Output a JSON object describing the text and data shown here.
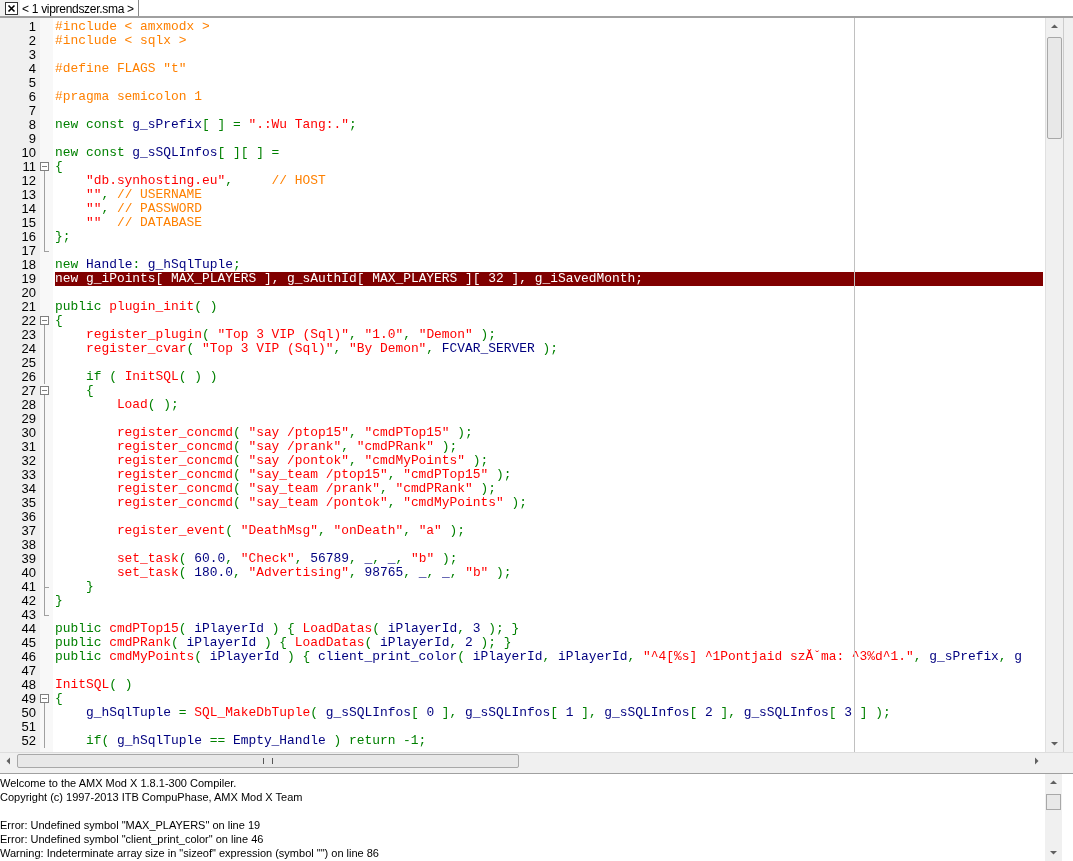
{
  "tab": {
    "label": "< 1 viprendszer.sma >",
    "selected": true
  },
  "lines": [
    {
      "number": "1",
      "kind": "plain",
      "highlighted": false,
      "tokens": [
        {
          "kind": "pre",
          "text": "#include < amxmodx >"
        }
      ]
    },
    {
      "number": "2",
      "kind": "plain",
      "highlighted": false,
      "tokens": [
        {
          "kind": "pre",
          "text": "#include < sqlx >"
        }
      ]
    },
    {
      "number": "3",
      "kind": "plain",
      "highlighted": false
    },
    {
      "number": "4",
      "kind": "plain",
      "highlighted": false,
      "tokens": [
        {
          "kind": "pre",
          "text": "#define FLAGS \"t\""
        }
      ]
    },
    {
      "number": "5",
      "kind": "plain",
      "highlighted": false
    },
    {
      "number": "6",
      "kind": "plain",
      "highlighted": false,
      "tokens": [
        {
          "kind": "pre",
          "text": "#pragma semicolon 1"
        }
      ]
    },
    {
      "number": "7",
      "kind": "plain",
      "highlighted": false
    },
    {
      "number": "8",
      "kind": "plain",
      "highlighted": false,
      "tokens": [
        {
          "kind": "kw",
          "text": "new const "
        },
        {
          "kind": "id",
          "text": "g_sPrefix"
        },
        {
          "kind": "kw",
          "text": "[ ] = "
        },
        {
          "kind": "str",
          "text": "\".:Wu Tang:.\""
        },
        {
          "kind": "kw",
          "text": ";"
        }
      ]
    },
    {
      "number": "9",
      "kind": "plain",
      "highlighted": false
    },
    {
      "number": "10",
      "kind": "plain",
      "highlighted": false,
      "tokens": [
        {
          "kind": "kw",
          "text": "new const "
        },
        {
          "kind": "id",
          "text": "g_sSQLInfos"
        },
        {
          "kind": "kw",
          "text": "[ ][ ] ="
        }
      ]
    },
    {
      "number": "11",
      "kind": "fold-start",
      "highlighted": false,
      "tokens": [
        {
          "kind": "kw",
          "text": "{"
        }
      ]
    },
    {
      "number": "12",
      "kind": "fold-body",
      "highlighted": false,
      "tokens": [
        {
          "kind": "str",
          "text": "    \"db.synhosting.eu\""
        },
        {
          "kind": "kw",
          "text": ",     "
        },
        {
          "kind": "cm",
          "text": "// HOST"
        }
      ]
    },
    {
      "number": "13",
      "kind": "fold-body",
      "highlighted": false,
      "tokens": [
        {
          "kind": "str",
          "text": "    \"\""
        },
        {
          "kind": "kw",
          "text": ", "
        },
        {
          "kind": "cm",
          "text": "// USERNAME"
        }
      ]
    },
    {
      "number": "14",
      "kind": "fold-body",
      "highlighted": false,
      "tokens": [
        {
          "kind": "str",
          "text": "    \"\""
        },
        {
          "kind": "kw",
          "text": ", "
        },
        {
          "kind": "cm",
          "text": "// PASSWORD"
        }
      ]
    },
    {
      "number": "15",
      "kind": "fold-body",
      "highlighted": false,
      "tokens": [
        {
          "kind": "str",
          "text": "    \"\""
        },
        {
          "kind": "cm",
          "text": "  // DATABASE"
        }
      ]
    },
    {
      "number": "16",
      "kind": "fold-body",
      "highlighted": false,
      "tokens": [
        {
          "kind": "kw",
          "text": "};"
        }
      ]
    },
    {
      "number": "17",
      "kind": "fold-end",
      "highlighted": false
    },
    {
      "number": "18",
      "kind": "plain",
      "highlighted": false,
      "tokens": [
        {
          "kind": "kw",
          "text": "new "
        },
        {
          "kind": "id",
          "text": "Handle"
        },
        {
          "kind": "kw",
          "text": ": "
        },
        {
          "kind": "id",
          "text": "g_hSqlTuple"
        },
        {
          "kind": "kw",
          "text": ";"
        }
      ]
    },
    {
      "number": "19",
      "kind": "plain",
      "highlighted": true,
      "tokens": [
        {
          "kind": "kw",
          "text": "new "
        },
        {
          "kind": "id",
          "text": "g_iPoints"
        },
        {
          "kind": "kw",
          "text": "[ "
        },
        {
          "kind": "id",
          "text": "MAX_PLAYERS"
        },
        {
          "kind": "kw",
          "text": " ], "
        },
        {
          "kind": "id",
          "text": "g_sAuthId"
        },
        {
          "kind": "kw",
          "text": "[ "
        },
        {
          "kind": "id",
          "text": "MAX_PLAYERS"
        },
        {
          "kind": "kw",
          "text": " ][ "
        },
        {
          "kind": "num",
          "text": "32"
        },
        {
          "kind": "kw",
          "text": " ], "
        },
        {
          "kind": "id",
          "text": "g_iSavedMonth"
        },
        {
          "kind": "kw",
          "text": ";"
        }
      ]
    },
    {
      "number": "20",
      "kind": "plain",
      "highlighted": false
    },
    {
      "number": "21",
      "kind": "plain",
      "highlighted": false,
      "tokens": [
        {
          "kind": "kw",
          "text": "public "
        },
        {
          "kind": "fn",
          "text": "plugin_init"
        },
        {
          "kind": "kw",
          "text": "( )"
        }
      ]
    },
    {
      "number": "22",
      "kind": "fold-start",
      "highlighted": false,
      "tokens": [
        {
          "kind": "kw",
          "text": "{"
        }
      ]
    },
    {
      "number": "23",
      "kind": "fold-body",
      "highlighted": false,
      "tokens": [
        {
          "kind": "fn",
          "text": "    register_plugin"
        },
        {
          "kind": "kw",
          "text": "( "
        },
        {
          "kind": "str",
          "text": "\"Top 3 VIP (Sql)\""
        },
        {
          "kind": "kw",
          "text": ", "
        },
        {
          "kind": "str",
          "text": "\"1.0\""
        },
        {
          "kind": "kw",
          "text": ", "
        },
        {
          "kind": "str",
          "text": "\"Demon\""
        },
        {
          "kind": "kw",
          "text": " );"
        }
      ]
    },
    {
      "number": "24",
      "kind": "fold-body",
      "highlighted": false,
      "tokens": [
        {
          "kind": "fn",
          "text": "    register_cvar"
        },
        {
          "kind": "kw",
          "text": "( "
        },
        {
          "kind": "str",
          "text": "\"Top 3 VIP (Sql)\""
        },
        {
          "kind": "kw",
          "text": ", "
        },
        {
          "kind": "str",
          "text": "\"By Demon\""
        },
        {
          "kind": "kw",
          "text": ", "
        },
        {
          "kind": "id",
          "text": "FCVAR_SERVER"
        },
        {
          "kind": "kw",
          "text": " );"
        }
      ]
    },
    {
      "number": "25",
      "kind": "fold-body",
      "highlighted": false
    },
    {
      "number": "26",
      "kind": "fold-body",
      "highlighted": false,
      "tokens": [
        {
          "kind": "kw",
          "text": "    if ( "
        },
        {
          "kind": "fn",
          "text": "InitSQL"
        },
        {
          "kind": "kw",
          "text": "( ) )"
        }
      ]
    },
    {
      "number": "27",
      "kind": "fold-start",
      "highlighted": false,
      "tokens": [
        {
          "kind": "kw",
          "text": "    {"
        }
      ]
    },
    {
      "number": "28",
      "kind": "fold-body",
      "highlighted": false,
      "tokens": [
        {
          "kind": "fn",
          "text": "        Load"
        },
        {
          "kind": "kw",
          "text": "( );"
        }
      ]
    },
    {
      "number": "29",
      "kind": "fold-body",
      "highlighted": false
    },
    {
      "number": "30",
      "kind": "fold-body",
      "highlighted": false,
      "tokens": [
        {
          "kind": "fn",
          "text": "        register_concmd"
        },
        {
          "kind": "kw",
          "text": "( "
        },
        {
          "kind": "str",
          "text": "\"say /ptop15\""
        },
        {
          "kind": "kw",
          "text": ", "
        },
        {
          "kind": "str",
          "text": "\"cmdPTop15\""
        },
        {
          "kind": "kw",
          "text": " );"
        }
      ]
    },
    {
      "number": "31",
      "kind": "fold-body",
      "highlighted": false,
      "tokens": [
        {
          "kind": "fn",
          "text": "        register_concmd"
        },
        {
          "kind": "kw",
          "text": "( "
        },
        {
          "kind": "str",
          "text": "\"say /prank\""
        },
        {
          "kind": "kw",
          "text": ", "
        },
        {
          "kind": "str",
          "text": "\"cmdPRank\""
        },
        {
          "kind": "kw",
          "text": " );"
        }
      ]
    },
    {
      "number": "32",
      "kind": "fold-body",
      "highlighted": false,
      "tokens": [
        {
          "kind": "fn",
          "text": "        register_concmd"
        },
        {
          "kind": "kw",
          "text": "( "
        },
        {
          "kind": "str",
          "text": "\"say /pontok\""
        },
        {
          "kind": "kw",
          "text": ", "
        },
        {
          "kind": "str",
          "text": "\"cmdMyPoints\""
        },
        {
          "kind": "kw",
          "text": " );"
        }
      ]
    },
    {
      "number": "33",
      "kind": "fold-body",
      "highlighted": false,
      "tokens": [
        {
          "kind": "fn",
          "text": "        register_concmd"
        },
        {
          "kind": "kw",
          "text": "( "
        },
        {
          "kind": "str",
          "text": "\"say_team /ptop15\""
        },
        {
          "kind": "kw",
          "text": ", "
        },
        {
          "kind": "str",
          "text": "\"cmdPTop15\""
        },
        {
          "kind": "kw",
          "text": " );"
        }
      ]
    },
    {
      "number": "34",
      "kind": "fold-body",
      "highlighted": false,
      "tokens": [
        {
          "kind": "fn",
          "text": "        register_concmd"
        },
        {
          "kind": "kw",
          "text": "( "
        },
        {
          "kind": "str",
          "text": "\"say_team /prank\""
        },
        {
          "kind": "kw",
          "text": ", "
        },
        {
          "kind": "str",
          "text": "\"cmdPRank\""
        },
        {
          "kind": "kw",
          "text": " );"
        }
      ]
    },
    {
      "number": "35",
      "kind": "fold-body",
      "highlighted": false,
      "tokens": [
        {
          "kind": "fn",
          "text": "        register_concmd"
        },
        {
          "kind": "kw",
          "text": "( "
        },
        {
          "kind": "str",
          "text": "\"say_team /pontok\""
        },
        {
          "kind": "kw",
          "text": ", "
        },
        {
          "kind": "str",
          "text": "\"cmdMyPoints\""
        },
        {
          "kind": "kw",
          "text": " );"
        }
      ]
    },
    {
      "number": "36",
      "kind": "fold-body",
      "highlighted": false
    },
    {
      "number": "37",
      "kind": "fold-body",
      "highlighted": false,
      "tokens": [
        {
          "kind": "fn",
          "text": "        register_event"
        },
        {
          "kind": "kw",
          "text": "( "
        },
        {
          "kind": "str",
          "text": "\"DeathMsg\""
        },
        {
          "kind": "kw",
          "text": ", "
        },
        {
          "kind": "str",
          "text": "\"onDeath\""
        },
        {
          "kind": "kw",
          "text": ", "
        },
        {
          "kind": "str",
          "text": "\"a\""
        },
        {
          "kind": "kw",
          "text": " );"
        }
      ]
    },
    {
      "number": "38",
      "kind": "fold-body",
      "highlighted": false
    },
    {
      "number": "39",
      "kind": "fold-body",
      "highlighted": false,
      "tokens": [
        {
          "kind": "fn",
          "text": "        set_task"
        },
        {
          "kind": "kw",
          "text": "( "
        },
        {
          "kind": "num",
          "text": "60.0"
        },
        {
          "kind": "kw",
          "text": ", "
        },
        {
          "kind": "str",
          "text": "\"Check\""
        },
        {
          "kind": "kw",
          "text": ", "
        },
        {
          "kind": "num",
          "text": "56789"
        },
        {
          "kind": "kw",
          "text": ", "
        },
        {
          "kind": "id",
          "text": "_"
        },
        {
          "kind": "kw",
          "text": ", "
        },
        {
          "kind": "id",
          "text": "_"
        },
        {
          "kind": "kw",
          "text": ", "
        },
        {
          "kind": "str",
          "text": "\"b\""
        },
        {
          "kind": "kw",
          "text": " );"
        }
      ]
    },
    {
      "number": "40",
      "kind": "fold-body",
      "highlighted": false,
      "tokens": [
        {
          "kind": "fn",
          "text": "        set_task"
        },
        {
          "kind": "kw",
          "text": "( "
        },
        {
          "kind": "num",
          "text": "180.0"
        },
        {
          "kind": "kw",
          "text": ", "
        },
        {
          "kind": "str",
          "text": "\"Advertising\""
        },
        {
          "kind": "kw",
          "text": ", "
        },
        {
          "kind": "num",
          "text": "98765"
        },
        {
          "kind": "kw",
          "text": ", "
        },
        {
          "kind": "id",
          "text": "_"
        },
        {
          "kind": "kw",
          "text": ", "
        },
        {
          "kind": "id",
          "text": "_"
        },
        {
          "kind": "kw",
          "text": ", "
        },
        {
          "kind": "str",
          "text": "\"b\""
        },
        {
          "kind": "kw",
          "text": " );"
        }
      ]
    },
    {
      "number": "41",
      "kind": "fold-tick",
      "highlighted": false,
      "tokens": [
        {
          "kind": "kw",
          "text": "    }"
        }
      ]
    },
    {
      "number": "42",
      "kind": "fold-body",
      "highlighted": false,
      "tokens": [
        {
          "kind": "kw",
          "text": "}"
        }
      ]
    },
    {
      "number": "43",
      "kind": "fold-end",
      "highlighted": false
    },
    {
      "number": "44",
      "kind": "plain",
      "highlighted": false,
      "tokens": [
        {
          "kind": "kw",
          "text": "public "
        },
        {
          "kind": "fn",
          "text": "cmdPTop15"
        },
        {
          "kind": "kw",
          "text": "( "
        },
        {
          "kind": "id",
          "text": "iPlayerId"
        },
        {
          "kind": "kw",
          "text": " ) { "
        },
        {
          "kind": "fn",
          "text": "LoadDatas"
        },
        {
          "kind": "kw",
          "text": "( "
        },
        {
          "kind": "id",
          "text": "iPlayerId"
        },
        {
          "kind": "kw",
          "text": ", "
        },
        {
          "kind": "num",
          "text": "3"
        },
        {
          "kind": "kw",
          "text": " ); }"
        }
      ]
    },
    {
      "number": "45",
      "kind": "plain",
      "highlighted": false,
      "tokens": [
        {
          "kind": "kw",
          "text": "public "
        },
        {
          "kind": "fn",
          "text": "cmdPRank"
        },
        {
          "kind": "kw",
          "text": "( "
        },
        {
          "kind": "id",
          "text": "iPlayerId"
        },
        {
          "kind": "kw",
          "text": " ) { "
        },
        {
          "kind": "fn",
          "text": "LoadDatas"
        },
        {
          "kind": "kw",
          "text": "( "
        },
        {
          "kind": "id",
          "text": "iPlayerId"
        },
        {
          "kind": "kw",
          "text": ", "
        },
        {
          "kind": "num",
          "text": "2"
        },
        {
          "kind": "kw",
          "text": " ); }"
        }
      ]
    },
    {
      "number": "46",
      "kind": "plain",
      "highlighted": false,
      "tokens": [
        {
          "kind": "kw",
          "text": "public "
        },
        {
          "kind": "fn",
          "text": "cmdMyPoints"
        },
        {
          "kind": "kw",
          "text": "( "
        },
        {
          "kind": "id",
          "text": "iPlayerId"
        },
        {
          "kind": "kw",
          "text": " ) { "
        },
        {
          "kind": "id",
          "text": "client_print_color"
        },
        {
          "kind": "kw",
          "text": "( "
        },
        {
          "kind": "id",
          "text": "iPlayerId"
        },
        {
          "kind": "kw",
          "text": ", "
        },
        {
          "kind": "id",
          "text": "iPlayerId"
        },
        {
          "kind": "kw",
          "text": ", "
        },
        {
          "kind": "str",
          "text": "\"^4[%s] ^1Pontjaid szĂˇma: ^3%d^1.\""
        },
        {
          "kind": "kw",
          "text": ", "
        },
        {
          "kind": "id",
          "text": "g_sPrefix"
        },
        {
          "kind": "kw",
          "text": ", "
        },
        {
          "kind": "id",
          "text": "g"
        }
      ]
    },
    {
      "number": "47",
      "kind": "plain",
      "highlighted": false
    },
    {
      "number": "48",
      "kind": "plain",
      "highlighted": false,
      "tokens": [
        {
          "kind": "fn",
          "text": "InitSQL"
        },
        {
          "kind": "kw",
          "text": "( )"
        }
      ]
    },
    {
      "number": "49",
      "kind": "fold-start",
      "highlighted": false,
      "tokens": [
        {
          "kind": "kw",
          "text": "{"
        }
      ]
    },
    {
      "number": "50",
      "kind": "fold-body",
      "highlighted": false,
      "tokens": [
        {
          "kind": "id",
          "text": "    g_hSqlTuple"
        },
        {
          "kind": "kw",
          "text": " = "
        },
        {
          "kind": "fn",
          "text": "SQL_MakeDbTuple"
        },
        {
          "kind": "kw",
          "text": "( "
        },
        {
          "kind": "id",
          "text": "g_sSQLInfos"
        },
        {
          "kind": "kw",
          "text": "[ "
        },
        {
          "kind": "num",
          "text": "0"
        },
        {
          "kind": "kw",
          "text": " ], "
        },
        {
          "kind": "id",
          "text": "g_sSQLInfos"
        },
        {
          "kind": "kw",
          "text": "[ "
        },
        {
          "kind": "num",
          "text": "1"
        },
        {
          "kind": "kw",
          "text": " ], "
        },
        {
          "kind": "id",
          "text": "g_sSQLInfos"
        },
        {
          "kind": "kw",
          "text": "[ "
        },
        {
          "kind": "num",
          "text": "2"
        },
        {
          "kind": "kw",
          "text": " ], "
        },
        {
          "kind": "id",
          "text": "g_sSQLInfos"
        },
        {
          "kind": "kw",
          "text": "[ "
        },
        {
          "kind": "num",
          "text": "3"
        },
        {
          "kind": "kw",
          "text": " ] );"
        }
      ]
    },
    {
      "number": "51",
      "kind": "fold-body",
      "highlighted": false
    },
    {
      "number": "52",
      "kind": "fold-body",
      "highlighted": false,
      "tokens": [
        {
          "kind": "kw",
          "text": "    if( "
        },
        {
          "kind": "id",
          "text": "g_hSqlTuple"
        },
        {
          "kind": "kw",
          "text": " == "
        },
        {
          "kind": "id",
          "text": "Empty_Handle"
        },
        {
          "kind": "kw",
          "text": " ) return -1;"
        }
      ]
    }
  ],
  "output": {
    "blocks": [
      [
        "Welcome to the AMX Mod X 1.8.1-300 Compiler.",
        "Copyright (c) 1997-2013 ITB CompuPhase, AMX Mod X Team"
      ],
      [
        "Error: Undefined symbol \"MAX_PLAYERS\" on line 19",
        "Error: Undefined symbol \"client_print_color\" on line 46",
        "Warning: Indeterminate array size in \"sizeof\" expression (symbol \"\") on line 86"
      ]
    ]
  }
}
